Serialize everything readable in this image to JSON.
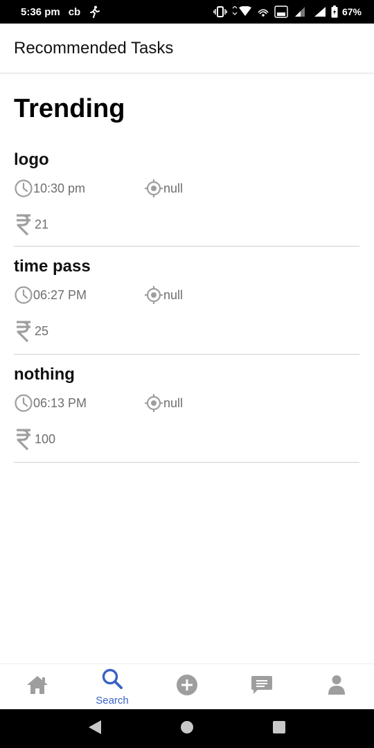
{
  "status_bar": {
    "time": "5:36 pm",
    "carrier_mark": "cb",
    "battery": "67%"
  },
  "app_bar": {
    "title": "Recommended Tasks"
  },
  "section": {
    "title": "Trending"
  },
  "tasks": [
    {
      "name": "logo",
      "time": "10:30 pm",
      "location": "null",
      "price": "21"
    },
    {
      "name": "time pass",
      "time": "06:27 PM",
      "location": "null",
      "price": "25"
    },
    {
      "name": "nothing",
      "time": "06:13 PM",
      "location": "null",
      "price": "100"
    }
  ],
  "bottom_nav": {
    "active_index": 1,
    "items": [
      {
        "icon": "home-icon",
        "label": ""
      },
      {
        "icon": "search-icon",
        "label": "Search"
      },
      {
        "icon": "add-circle-icon",
        "label": ""
      },
      {
        "icon": "chat-icon",
        "label": ""
      },
      {
        "icon": "profile-icon",
        "label": ""
      }
    ]
  },
  "colors": {
    "accent": "#3a62c4",
    "nav_inactive": "#9e9e9e",
    "meta_text": "#6e6e6e",
    "divider": "#cfcfcf"
  }
}
